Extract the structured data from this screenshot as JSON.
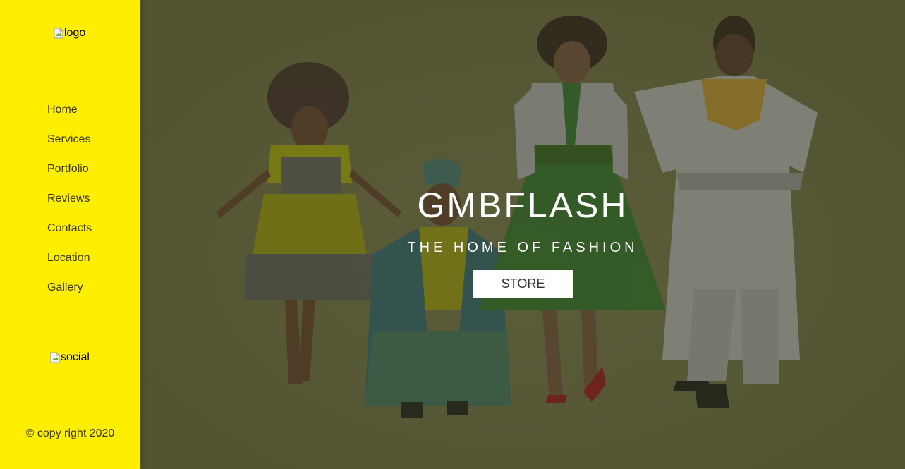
{
  "sidebar": {
    "logo_alt": "logo",
    "nav": [
      "Home",
      "Services",
      "Portfolio",
      "Reviews",
      "Contacts",
      "Location",
      "Gallery"
    ],
    "social_alt": "social",
    "copyright": "© copy right 2020"
  },
  "hero": {
    "title": "GMBFLASH",
    "subtitle": "THE HOME OF FASHION",
    "button_label": "STORE"
  },
  "colors": {
    "sidebar_bg": "#ffee00",
    "hero_overlay": "#63643f",
    "title_text": "#ffffff",
    "button_bg": "#ffffff"
  },
  "icons": {
    "broken_image": "broken-image-icon"
  }
}
